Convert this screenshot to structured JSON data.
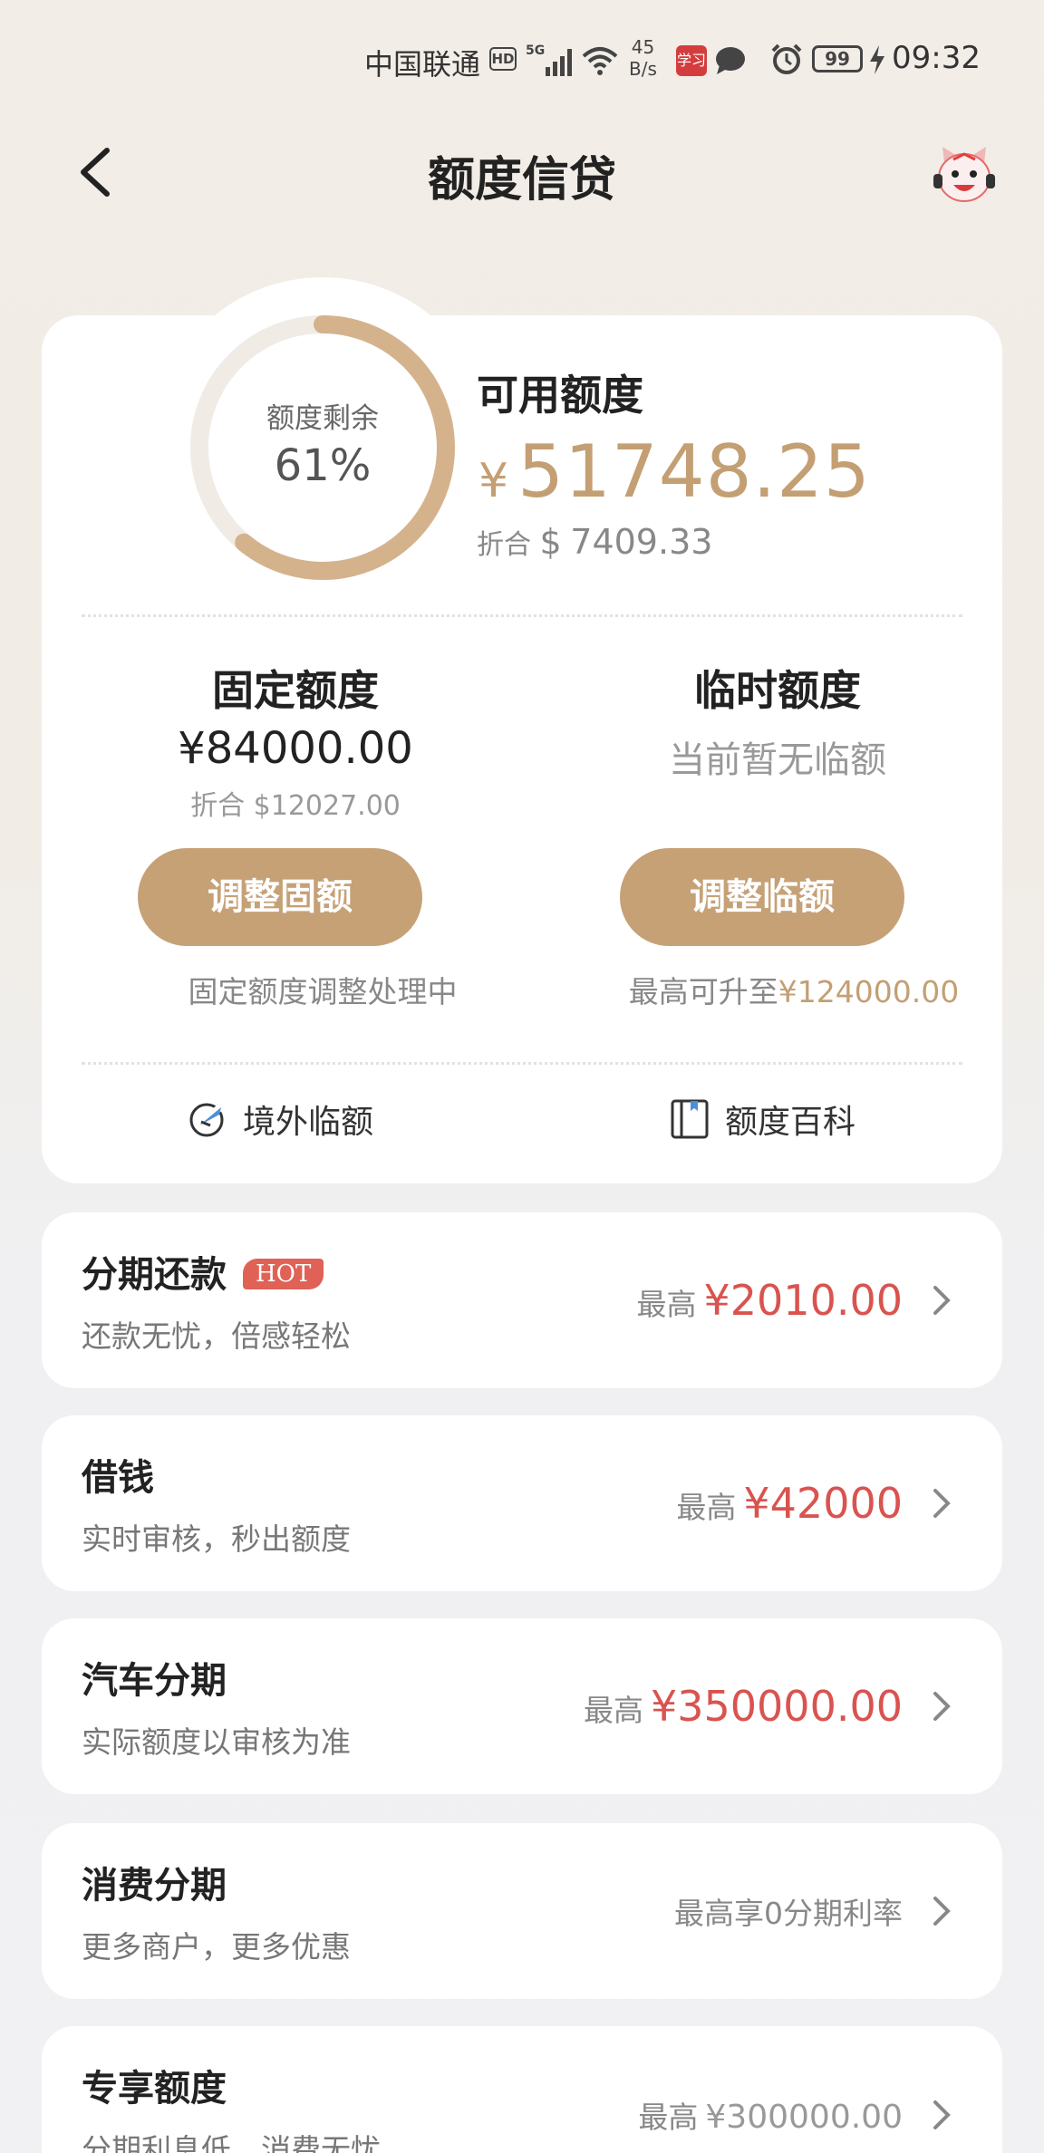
{
  "status_bar": {
    "carrier": "中国联通",
    "hd": "HD",
    "network": "5G",
    "speed_value": "45",
    "speed_unit": "B/s",
    "app_badge": "学习",
    "battery": "99",
    "time": "09:32"
  },
  "header": {
    "title": "额度信贷"
  },
  "summary": {
    "ring_label": "额度剩余",
    "ring_percent_text": "61%",
    "remaining_fraction": 0.61,
    "available_title": "可用额度",
    "available_currency": "¥",
    "available_amount": "51748.25",
    "usd_prefix": "折合",
    "usd_symbol": "$",
    "usd_amount": "7409.33",
    "accent_color": "#c6a176"
  },
  "fixed_limit": {
    "title": "固定额度",
    "amount": "¥84000.00",
    "usd": "折合 $12027.00",
    "button_label": "调整固额",
    "hint": "固定额度调整处理中"
  },
  "temp_limit": {
    "title": "临时额度",
    "note": "当前暂无临额",
    "button_label": "调整临额",
    "hint_prefix": "最高可升至",
    "hint_amount": "¥124000.00"
  },
  "links": {
    "overseas_label": "境外临额",
    "overseas_icon": "plane-globe-icon",
    "wiki_label": "额度百科",
    "wiki_icon": "book-icon"
  },
  "list": {
    "installment": {
      "title": "分期还款",
      "badge": "HOT",
      "subtitle": "还款无忧，倍感轻松",
      "prefix": "最高",
      "amount": "¥2010.00"
    },
    "borrow": {
      "title": "借钱",
      "subtitle": "实时审核，秒出额度",
      "prefix": "最高",
      "amount": "¥42000"
    },
    "car": {
      "title": "汽车分期",
      "subtitle": "实际额度以审核为准",
      "prefix": "最高",
      "amount": "¥350000.00"
    },
    "consumer": {
      "title": "消费分期",
      "subtitle": "更多商户，更多优惠",
      "right_text": "最高享0分期利率"
    },
    "exclusive": {
      "title": "专享额度",
      "subtitle": "分期利息低，消费无忧",
      "prefix": "最高",
      "amount": "¥300000.00"
    }
  }
}
